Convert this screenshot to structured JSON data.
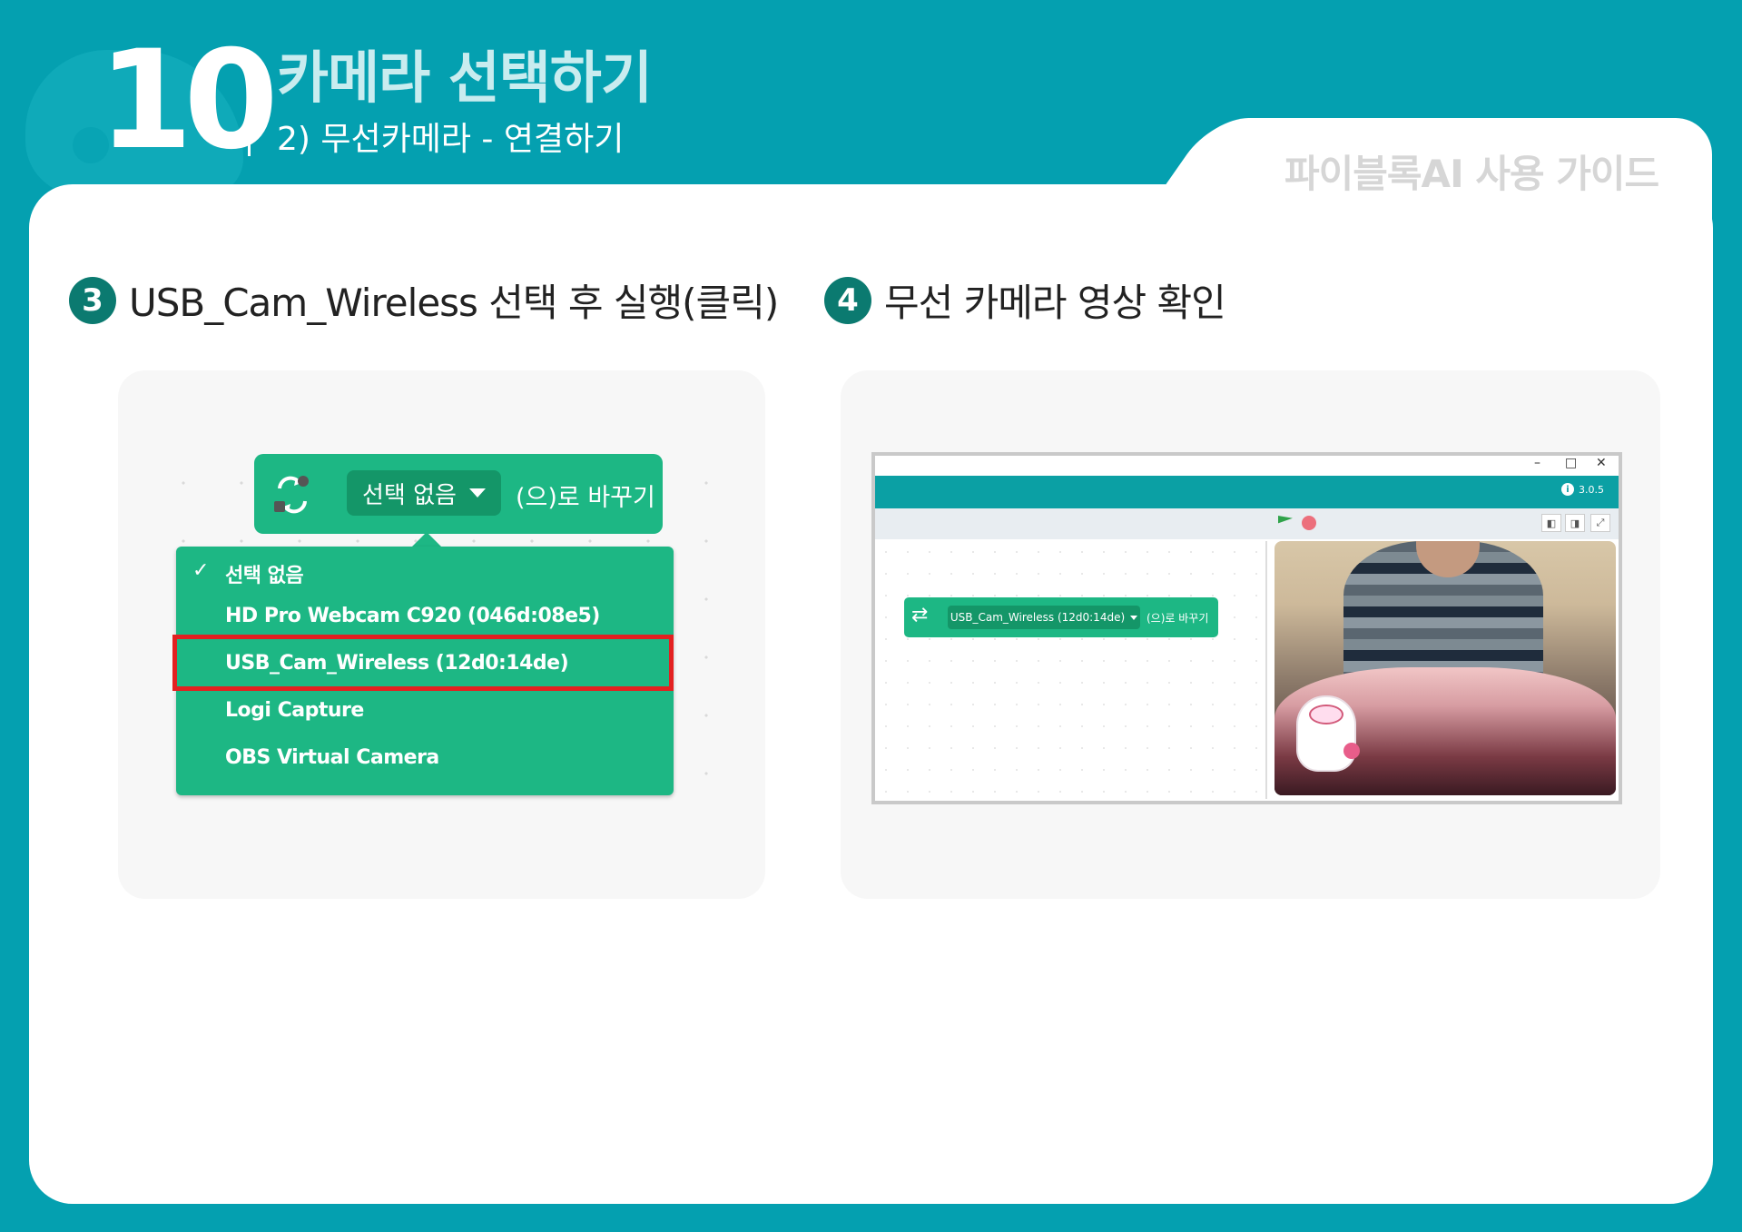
{
  "header": {
    "chapter_number": "10",
    "title": "카메라 선택하기",
    "subtitle": "2) 무선카메라 - 연결하기",
    "guide_label": "파이블록AI 사용 가이드"
  },
  "steps": [
    {
      "number": "3",
      "text": "USB_Cam_Wireless 선택 후 실행(클릭)"
    },
    {
      "number": "4",
      "text": "무선 카메라 영상 확인"
    }
  ],
  "block": {
    "dropdown_value": "선택 없음",
    "suffix": "(으)로 바꾸기",
    "icon": "camera-switch-icon"
  },
  "dropdown_menu": {
    "check_mark": "✓",
    "items": [
      {
        "label": "선택 없음",
        "checked": true
      },
      {
        "label": "HD Pro Webcam C920 (046d:08e5)",
        "checked": false
      },
      {
        "label": "USB_Cam_Wireless (12d0:14de)",
        "checked": false,
        "highlighted": true
      },
      {
        "label": "Logi Capture",
        "checked": false
      },
      {
        "label": "OBS Virtual Camera",
        "checked": false
      }
    ],
    "highlight_color": "#e32020"
  },
  "app_window": {
    "controls": {
      "minimize": "–",
      "maximize": "□",
      "close": "✕"
    },
    "version": "3.0.5",
    "block": {
      "dropdown_value": "USB_Cam_Wireless (12d0:14de)",
      "suffix": "(으)로 바꾸기"
    }
  },
  "colors": {
    "brand": "#04a0b0",
    "block_green": "#1db784",
    "badge": "#0b7a70"
  }
}
